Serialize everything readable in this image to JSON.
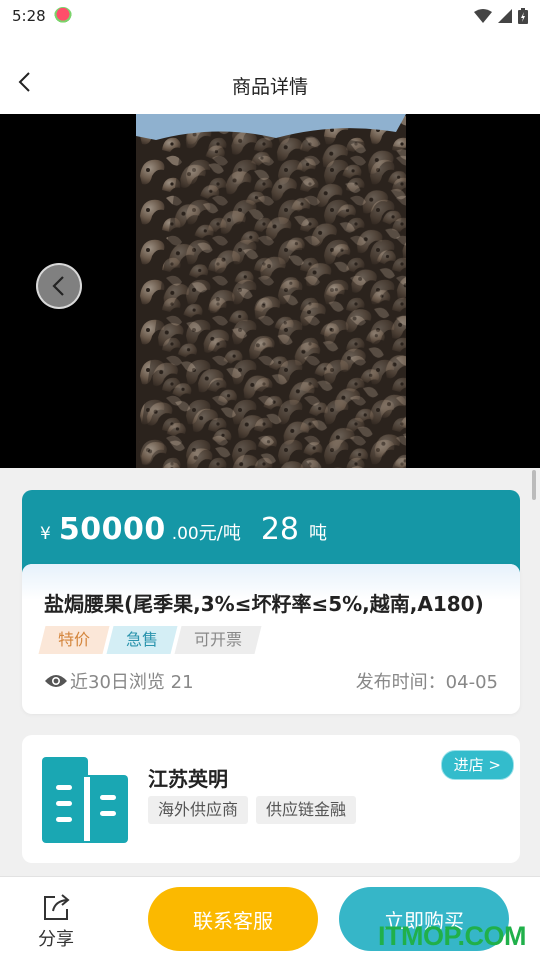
{
  "status_bar": {
    "time": "5:28",
    "icons": [
      "app-notification-icon",
      "wifi-icon",
      "cellular-signal-icon",
      "battery-icon"
    ]
  },
  "nav": {
    "title": "商品详情",
    "back_icon": "back-arrow-icon"
  },
  "gallery": {
    "prev_icon": "chevron-left-icon"
  },
  "price": {
    "currency": "¥",
    "integer": "50000",
    "decimal": ".00",
    "unit": "元/吨",
    "quantity": "28",
    "quantity_unit": "吨"
  },
  "product": {
    "name": "盐焗腰果(尾季果,3%≤坏籽率≤5%,越南,A180)",
    "tags": [
      "特价",
      "急售",
      "可开票"
    ],
    "views_label": "近30日浏览 21",
    "publish_label": "发布时间：04-05"
  },
  "shop": {
    "name": "江苏英明",
    "tags": [
      "海外供应商",
      "供应链金融"
    ],
    "enter_label": "进店 >"
  },
  "bottom": {
    "share_label": "分享",
    "contact_label": "联系客服",
    "buy_label": "立即购买"
  },
  "watermark": "ITMOP.COM",
  "colors": {
    "accent": "#1597a6",
    "contact_button": "#fbb900",
    "buy_button": "#36b6c8",
    "watermark": "#20b04a"
  }
}
